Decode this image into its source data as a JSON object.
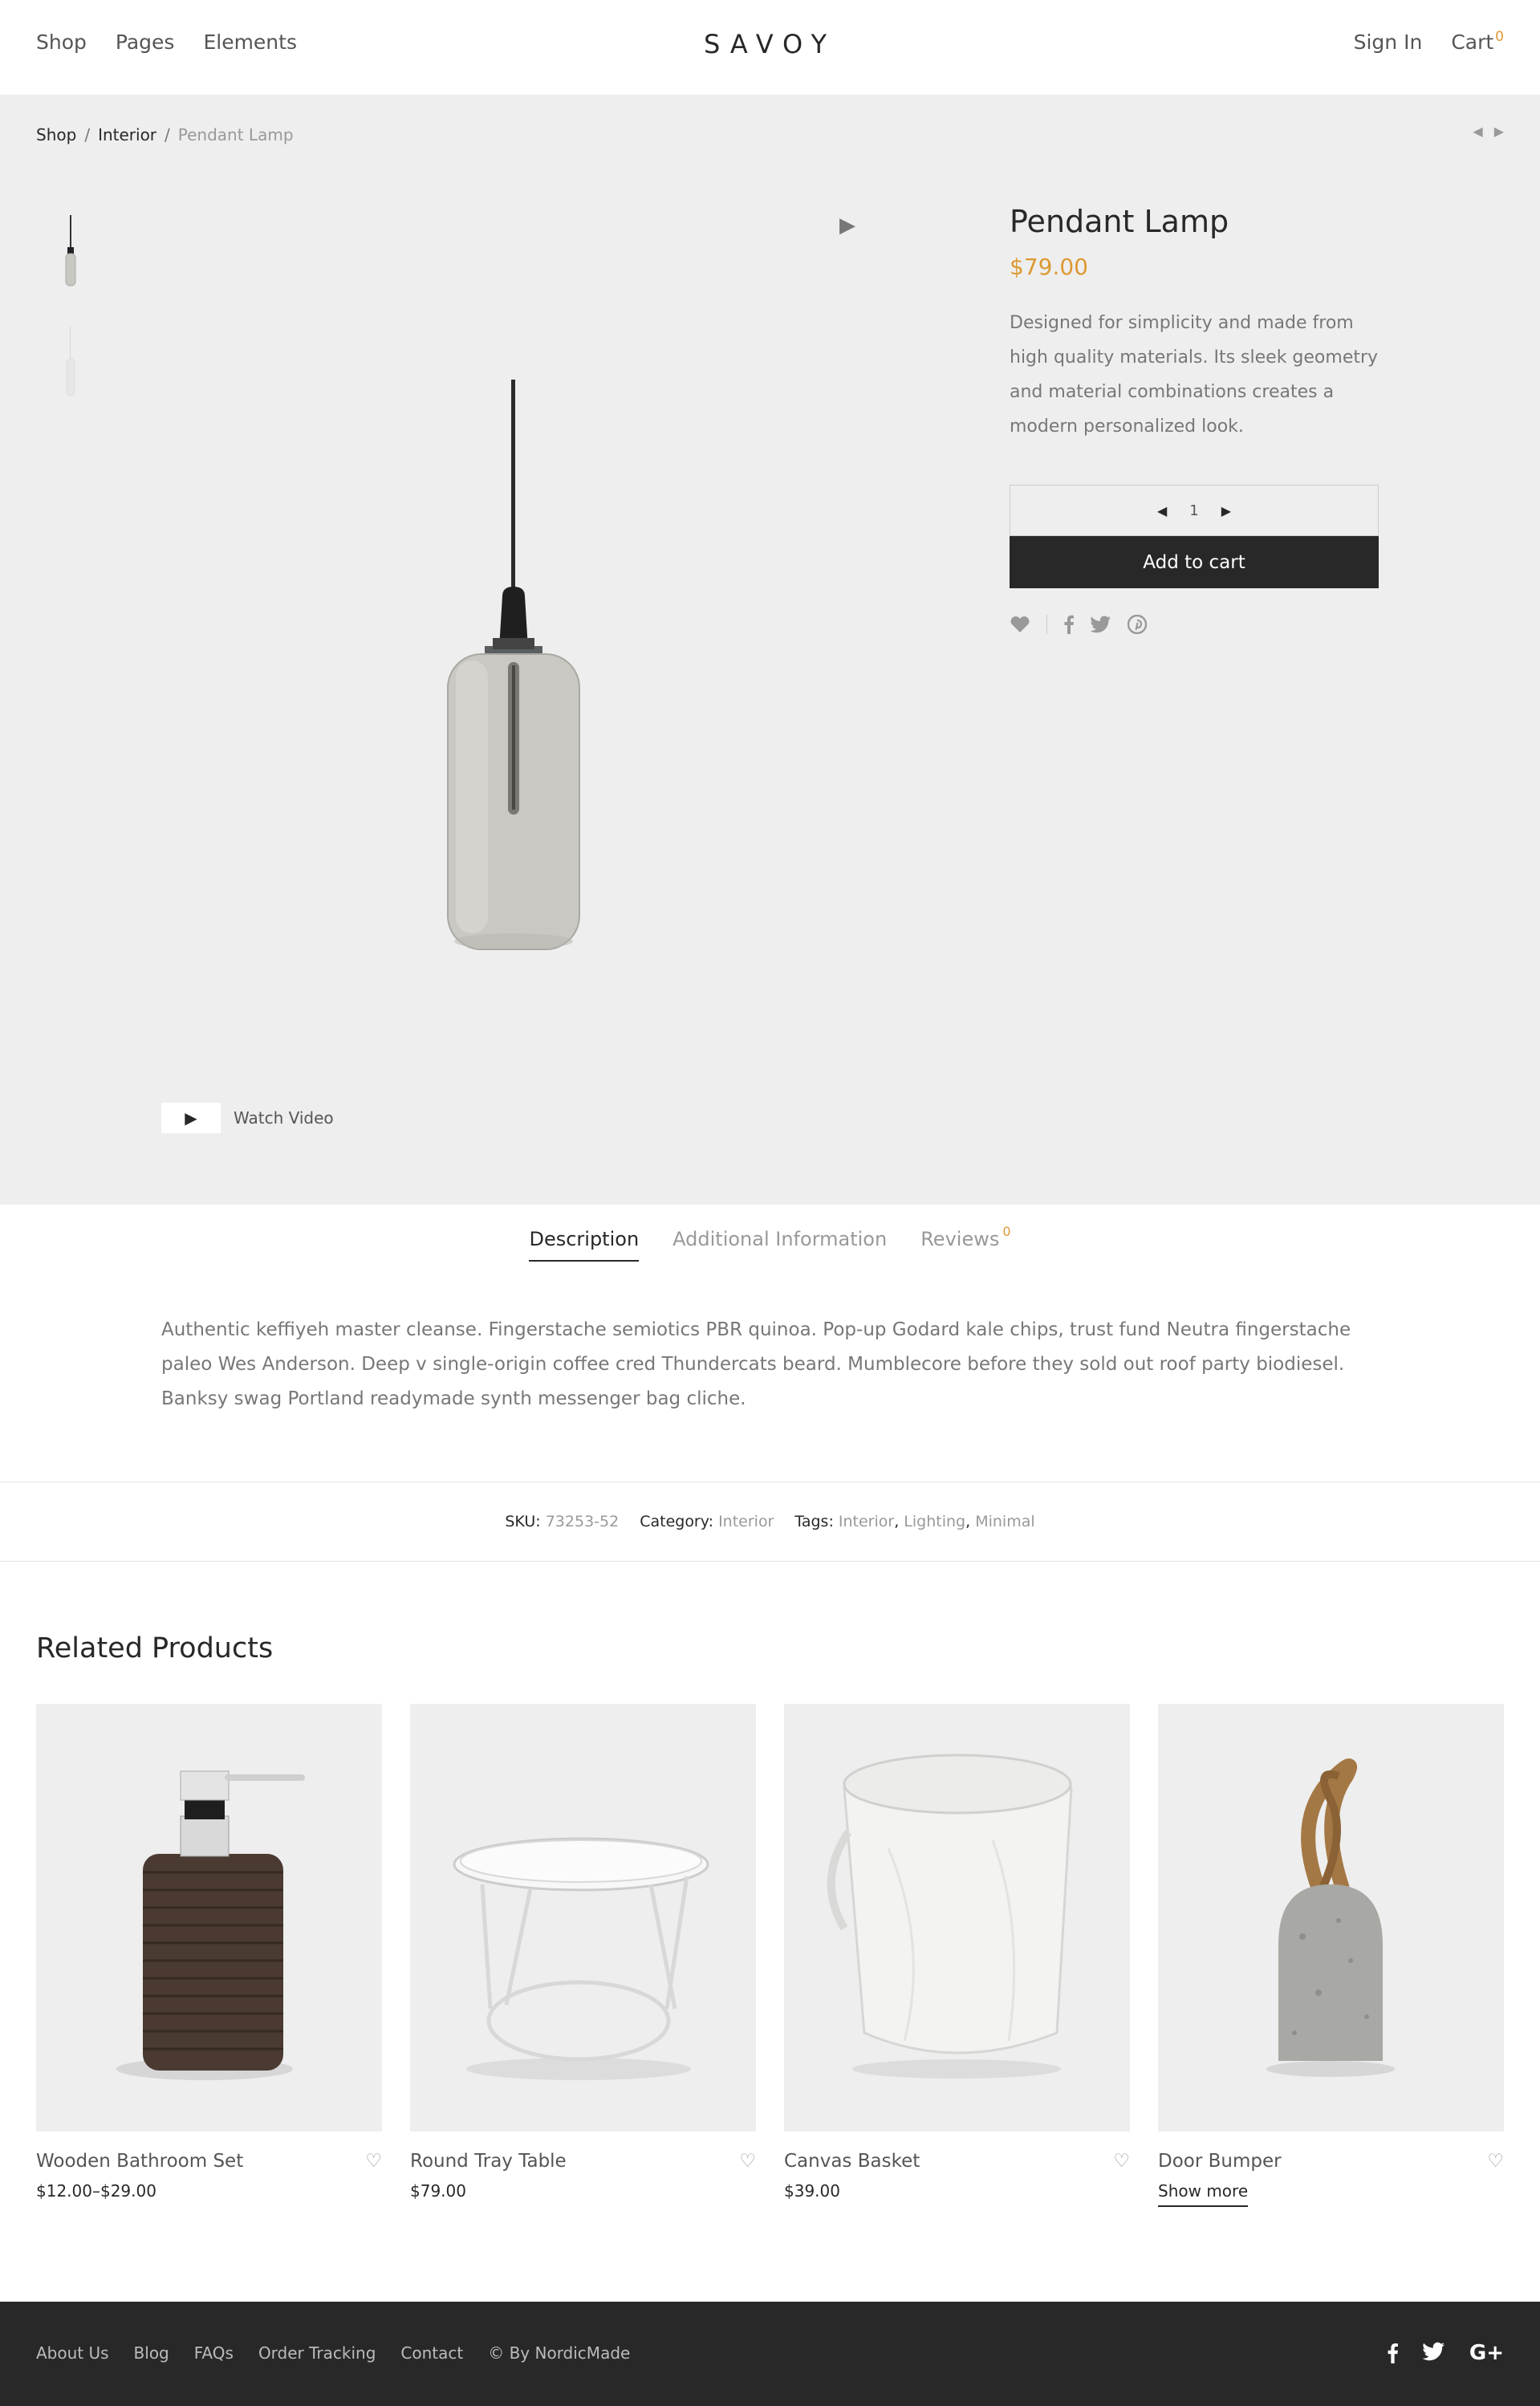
{
  "header": {
    "nav_left": [
      "Shop",
      "Pages",
      "Elements"
    ],
    "logo": "SAVOY",
    "sign_in": "Sign In",
    "cart_label": "Cart",
    "cart_count": "0"
  },
  "breadcrumb": {
    "items": [
      "Shop",
      "Interior",
      "Pendant Lamp"
    ],
    "separator": "/"
  },
  "pager_arrows": {
    "prev": "◀",
    "next": "▶"
  },
  "gallery": {
    "video_icon": "▶",
    "watch_video": "Watch Video"
  },
  "product": {
    "title": "Pendant Lamp",
    "price": "$79.00",
    "description": "Designed for simplicity and made from high quality materials. Its sleek geometry and material combinations creates a modern personalized look.",
    "quantity": "1",
    "qty_minus": "◀",
    "qty_plus": "▶",
    "add_to_cart": "Add to cart"
  },
  "tabs": {
    "description": "Description",
    "additional": "Additional Information",
    "reviews": "Reviews",
    "reviews_count": "0"
  },
  "description_text": "Authentic keffiyeh master cleanse. Fingerstache semiotics PBR quinoa. Pop-up Godard kale chips, trust fund Neutra fingerstache paleo Wes Anderson. Deep v single-origin coffee cred Thundercats beard. Mumblecore before they sold out roof party biodiesel. Banksy swag Portland readymade synth messenger bag cliche.",
  "meta": {
    "sku_label": "SKU:",
    "sku": "73253-52",
    "category_label": "Category:",
    "category": "Interior",
    "tags_label": "Tags:",
    "tags": [
      "Interior",
      "Lighting",
      "Minimal"
    ]
  },
  "related": {
    "title": "Related Products",
    "products": [
      {
        "name": "Wooden Bathroom Set",
        "price": "$12.00–$29.00"
      },
      {
        "name": "Round Tray Table",
        "price": "$79.00"
      },
      {
        "name": "Canvas Basket",
        "price": "$39.00"
      },
      {
        "name": "Door Bumper",
        "price": "Show more"
      }
    ]
  },
  "footer": {
    "links": [
      "About Us",
      "Blog",
      "FAQs",
      "Order Tracking",
      "Contact",
      "© By NordicMade"
    ],
    "social": [
      "facebook-icon",
      "twitter-icon",
      "google-plus-icon"
    ]
  },
  "colors": {
    "accent": "#dd9933",
    "dark": "#282828",
    "hero_bg": "#eeeeee"
  }
}
